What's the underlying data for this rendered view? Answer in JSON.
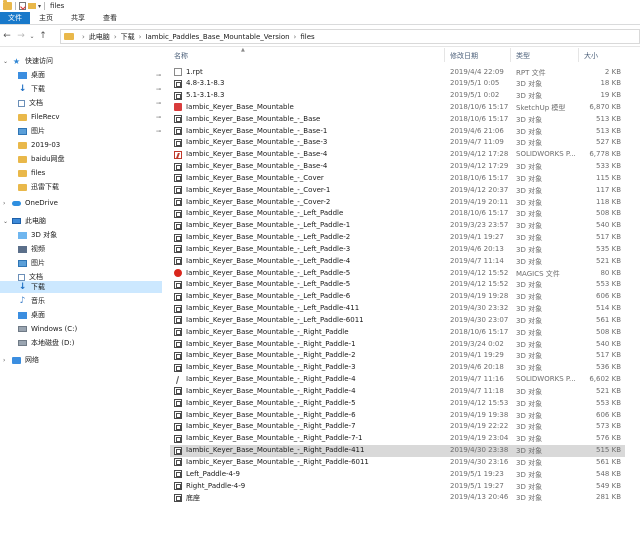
{
  "window": {
    "title": "files"
  },
  "ribbon": {
    "tabs": [
      "文件",
      "主页",
      "共享",
      "查看"
    ]
  },
  "address": {
    "crumbs": [
      "此电脑",
      "下载",
      "Iambic_Paddles_Base_Mountable_Version",
      "files"
    ]
  },
  "sidebar": {
    "items": [
      {
        "label": "快速访问",
        "icon": "star-icon"
      },
      {
        "label": "桌面",
        "icon": "desktop-icon",
        "pinned": true
      },
      {
        "label": "下载",
        "icon": "download-icon",
        "pinned": true
      },
      {
        "label": "文档",
        "icon": "document-icon",
        "pinned": true
      },
      {
        "label": "FileRecv",
        "icon": "folder-icon",
        "pinned": true
      },
      {
        "label": "图片",
        "icon": "pictures-icon",
        "pinned": true
      },
      {
        "label": "2019-03",
        "icon": "folder-icon"
      },
      {
        "label": "baidu网盘",
        "icon": "folder-icon"
      },
      {
        "label": "files",
        "icon": "folder-icon"
      },
      {
        "label": "迅雷下载",
        "icon": "folder-icon"
      },
      {
        "label": "OneDrive",
        "icon": "cloud-icon"
      },
      {
        "label": "此电脑",
        "icon": "computer-icon"
      },
      {
        "label": "3D 对象",
        "icon": "3d-objects-icon"
      },
      {
        "label": "视频",
        "icon": "video-icon"
      },
      {
        "label": "图片",
        "icon": "pictures-icon"
      },
      {
        "label": "文档",
        "icon": "document-icon"
      },
      {
        "label": "下载",
        "icon": "download-icon",
        "selected": true
      },
      {
        "label": "音乐",
        "icon": "music-icon"
      },
      {
        "label": "桌面",
        "icon": "desktop-icon"
      },
      {
        "label": "Windows (C:)",
        "icon": "drive-icon"
      },
      {
        "label": "本地磁盘 (D:)",
        "icon": "drive-icon"
      },
      {
        "label": "网络",
        "icon": "network-icon"
      }
    ]
  },
  "columns": {
    "name": "名称",
    "date": "修改日期",
    "type": "类型",
    "size": "大小"
  },
  "files": [
    {
      "name": "1.rpt",
      "date": "2019/4/4 22:09",
      "type": "RPT 文件",
      "size": "2 KB",
      "icon": "doc"
    },
    {
      "name": "4.8-3.1-8.3",
      "date": "2019/5/1 0:05",
      "type": "3D 对象",
      "size": "18 KB",
      "icon": "3d"
    },
    {
      "name": "5.1-3.1-8.3",
      "date": "2019/5/1 0:02",
      "type": "3D 对象",
      "size": "19 KB",
      "icon": "3d"
    },
    {
      "name": "Iambic_Keyer_Base_Mountable",
      "date": "2018/10/6 15:17",
      "type": "SketchUp 模型",
      "size": "6,870 KB",
      "icon": "sketch"
    },
    {
      "name": "Iambic_Keyer_Base_Mountable_-_Base",
      "date": "2018/10/6 15:17",
      "type": "3D 对象",
      "size": "513 KB",
      "icon": "3d"
    },
    {
      "name": "Iambic_Keyer_Base_Mountable_-_Base-1",
      "date": "2019/4/6 21:06",
      "type": "3D 对象",
      "size": "513 KB",
      "icon": "3d"
    },
    {
      "name": "Iambic_Keyer_Base_Mountable_-_Base-3",
      "date": "2019/4/7 11:09",
      "type": "3D 对象",
      "size": "527 KB",
      "icon": "3d"
    },
    {
      "name": "Iambic_Keyer_Base_Mountable_-_Base-4",
      "date": "2019/4/12 17:28",
      "type": "SOLIDWORKS P...",
      "size": "6,778 KB",
      "icon": "solid"
    },
    {
      "name": "Iambic_Keyer_Base_Mountable_-_Base-4",
      "date": "2019/4/12 17:29",
      "type": "3D 对象",
      "size": "533 KB",
      "icon": "3d"
    },
    {
      "name": "Iambic_Keyer_Base_Mountable_-_Cover",
      "date": "2018/10/6 15:17",
      "type": "3D 对象",
      "size": "115 KB",
      "icon": "3d"
    },
    {
      "name": "Iambic_Keyer_Base_Mountable_-_Cover-1",
      "date": "2019/4/12 20:37",
      "type": "3D 对象",
      "size": "117 KB",
      "icon": "3d"
    },
    {
      "name": "Iambic_Keyer_Base_Mountable_-_Cover-2",
      "date": "2019/4/19 20:11",
      "type": "3D 对象",
      "size": "118 KB",
      "icon": "3d"
    },
    {
      "name": "Iambic_Keyer_Base_Mountable_-_Left_Paddle",
      "date": "2018/10/6 15:17",
      "type": "3D 对象",
      "size": "508 KB",
      "icon": "3d"
    },
    {
      "name": "Iambic_Keyer_Base_Mountable_-_Left_Paddle-1",
      "date": "2019/3/23 23:57",
      "type": "3D 对象",
      "size": "540 KB",
      "icon": "3d"
    },
    {
      "name": "Iambic_Keyer_Base_Mountable_-_Left_Paddle-2",
      "date": "2019/4/1 19:27",
      "type": "3D 对象",
      "size": "517 KB",
      "icon": "3d"
    },
    {
      "name": "Iambic_Keyer_Base_Mountable_-_Left_Paddle-3",
      "date": "2019/4/6 20:13",
      "type": "3D 对象",
      "size": "535 KB",
      "icon": "3d"
    },
    {
      "name": "Iambic_Keyer_Base_Mountable_-_Left_Paddle-4",
      "date": "2019/4/7 11:14",
      "type": "3D 对象",
      "size": "521 KB",
      "icon": "3d"
    },
    {
      "name": "Iambic_Keyer_Base_Mountable_-_Left_Paddle-5",
      "date": "2019/4/12 15:52",
      "type": "MAGICS 文件",
      "size": "80 KB",
      "icon": "magics"
    },
    {
      "name": "Iambic_Keyer_Base_Mountable_-_Left_Paddle-5",
      "date": "2019/4/12 15:52",
      "type": "3D 对象",
      "size": "553 KB",
      "icon": "3d"
    },
    {
      "name": "Iambic_Keyer_Base_Mountable_-_Left_Paddle-6",
      "date": "2019/4/19 19:28",
      "type": "3D 对象",
      "size": "606 KB",
      "icon": "3d"
    },
    {
      "name": "Iambic_Keyer_Base_Mountable_-_Left_Paddle-411",
      "date": "2019/4/30 23:32",
      "type": "3D 对象",
      "size": "514 KB",
      "icon": "3d"
    },
    {
      "name": "Iambic_Keyer_Base_Mountable_-_Left_Paddle-6011",
      "date": "2019/4/30 23:07",
      "type": "3D 对象",
      "size": "561 KB",
      "icon": "3d"
    },
    {
      "name": "Iambic_Keyer_Base_Mountable_-_Right_Paddle",
      "date": "2018/10/6 15:17",
      "type": "3D 对象",
      "size": "508 KB",
      "icon": "3d"
    },
    {
      "name": "Iambic_Keyer_Base_Mountable_-_Right_Paddle-1",
      "date": "2019/3/24 0:02",
      "type": "3D 对象",
      "size": "540 KB",
      "icon": "3d"
    },
    {
      "name": "Iambic_Keyer_Base_Mountable_-_Right_Paddle-2",
      "date": "2019/4/1 19:29",
      "type": "3D 对象",
      "size": "517 KB",
      "icon": "3d"
    },
    {
      "name": "Iambic_Keyer_Base_Mountable_-_Right_Paddle-3",
      "date": "2019/4/6 20:18",
      "type": "3D 对象",
      "size": "536 KB",
      "icon": "3d"
    },
    {
      "name": "Iambic_Keyer_Base_Mountable_-_Right_Paddle-4",
      "date": "2019/4/7 11:16",
      "type": "SOLIDWORKS P...",
      "size": "6,602 KB",
      "icon": "solidthin"
    },
    {
      "name": "Iambic_Keyer_Base_Mountable_-_Right_Paddle-4",
      "date": "2019/4/7 11:18",
      "type": "3D 对象",
      "size": "521 KB",
      "icon": "3d"
    },
    {
      "name": "Iambic_Keyer_Base_Mountable_-_Right_Paddle-5",
      "date": "2019/4/12 15:53",
      "type": "3D 对象",
      "size": "553 KB",
      "icon": "3d"
    },
    {
      "name": "Iambic_Keyer_Base_Mountable_-_Right_Paddle-6",
      "date": "2019/4/19 19:38",
      "type": "3D 对象",
      "size": "606 KB",
      "icon": "3d"
    },
    {
      "name": "Iambic_Keyer_Base_Mountable_-_Right_Paddle-7",
      "date": "2019/4/19 22:22",
      "type": "3D 对象",
      "size": "573 KB",
      "icon": "3d"
    },
    {
      "name": "Iambic_Keyer_Base_Mountable_-_Right_Paddle-7-1",
      "date": "2019/4/19 23:04",
      "type": "3D 对象",
      "size": "576 KB",
      "icon": "3d"
    },
    {
      "name": "Iambic_Keyer_Base_Mountable_-_Right_Paddle-411",
      "date": "2019/4/30 23:38",
      "type": "3D 对象",
      "size": "515 KB",
      "icon": "3d",
      "selected": true
    },
    {
      "name": "Iambic_Keyer_Base_Mountable_-_Right_Paddle-6011",
      "date": "2019/4/30 23:16",
      "type": "3D 对象",
      "size": "561 KB",
      "icon": "3d"
    },
    {
      "name": "Left_Paddle-4-9",
      "date": "2019/5/1 19:23",
      "type": "3D 对象",
      "size": "548 KB",
      "icon": "3d"
    },
    {
      "name": "Right_Paddle-4-9",
      "date": "2019/5/1 19:27",
      "type": "3D 对象",
      "size": "549 KB",
      "icon": "3d"
    },
    {
      "name": "底座",
      "date": "2019/4/13 20:46",
      "type": "3D 对象",
      "size": "281 KB",
      "icon": "3d"
    }
  ]
}
